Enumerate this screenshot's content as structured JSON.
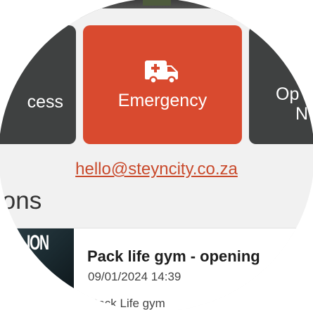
{
  "tiles": {
    "left": {
      "label": "cess"
    },
    "emergency": {
      "label": "Emergency",
      "icon": "ambulance-icon",
      "color": "#d94a2f"
    },
    "right": {
      "label_line1": "Op",
      "label_line2": "N"
    }
  },
  "contact": {
    "email": "hello@steyncity.co.za"
  },
  "section": {
    "title": "ions"
  },
  "news": {
    "items": [
      {
        "thumbnail_text": "ION",
        "title": "Pack life gym - opening",
        "date": "09/01/2024 14:39",
        "snippet": "Pack Life gym"
      }
    ]
  },
  "colors": {
    "accent": "#d94a2f",
    "tile_dark": "#3f4141",
    "link": "#c94a2c"
  }
}
